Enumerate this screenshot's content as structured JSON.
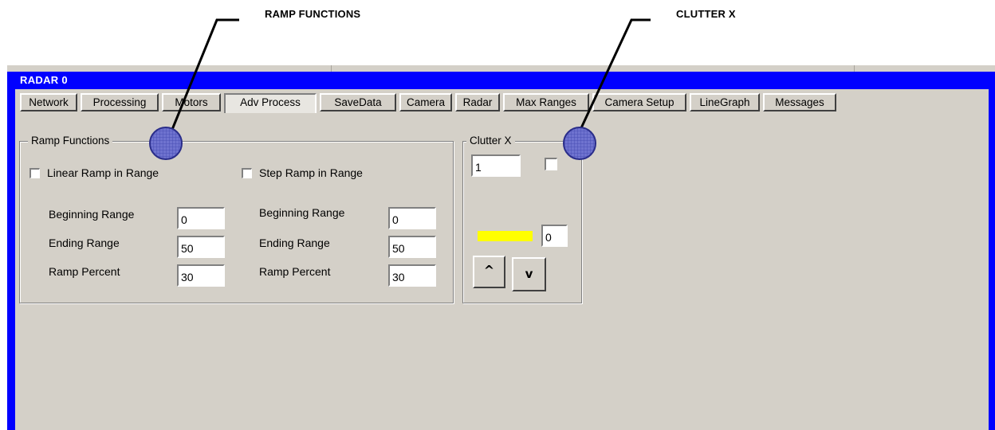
{
  "callouts": {
    "ramp": "RAMP FUNCTIONS",
    "clutter": "CLUTTER X"
  },
  "panel": {
    "title": "RADAR 0"
  },
  "tabs": [
    {
      "label": "Network",
      "active": false
    },
    {
      "label": "Processing",
      "active": false
    },
    {
      "label": "Motors",
      "active": false
    },
    {
      "label": "Adv Process",
      "active": true
    },
    {
      "label": "SaveData",
      "active": false
    },
    {
      "label": "Camera",
      "active": false
    },
    {
      "label": "Radar",
      "active": false
    },
    {
      "label": "Max Ranges",
      "active": false
    },
    {
      "label": "Camera Setup",
      "active": false
    },
    {
      "label": "LineGraph",
      "active": false
    },
    {
      "label": "Messages",
      "active": false
    }
  ],
  "ramp_functions": {
    "legend": "Ramp Functions",
    "linear": {
      "checkbox_label": "Linear Ramp in Range",
      "checked": false,
      "beginning_label": "Beginning Range",
      "beginning_value": "0",
      "ending_label": "Ending Range",
      "ending_value": "50",
      "percent_label": "Ramp Percent",
      "percent_value": "30"
    },
    "step": {
      "checkbox_label": "Step Ramp in Range",
      "checked": false,
      "beginning_label": "Beginning Range",
      "beginning_value": "0",
      "ending_label": "Ending Range",
      "ending_value": "50",
      "percent_label": "Ramp Percent",
      "percent_value": "30"
    }
  },
  "clutter_x": {
    "legend": "Clutter X",
    "value": "1",
    "checked": false,
    "color_swatch": "#ffff00",
    "level_value": "0",
    "up_label": "^",
    "down_label": "v"
  },
  "colors": {
    "panel_border": "#0000ff",
    "window_bg": "#d4d0c8",
    "marker_fill": "#6b6fc9",
    "marker_stroke": "#2a2d8a"
  }
}
